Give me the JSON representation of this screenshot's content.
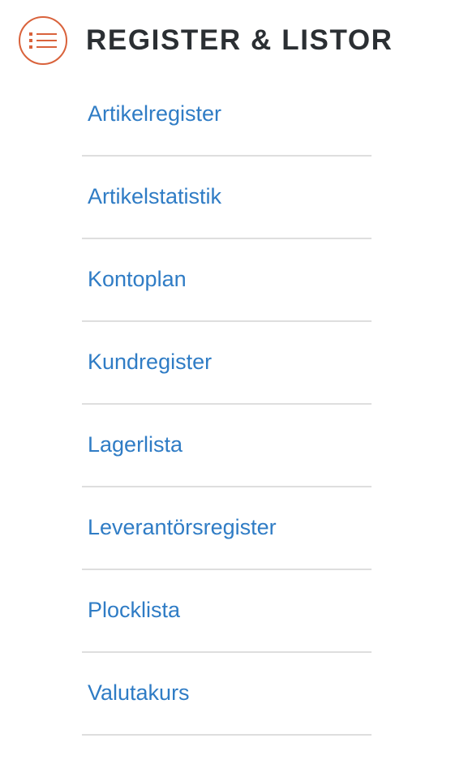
{
  "header": {
    "icon": "list-icon",
    "title": "REGISTER & LISTOR"
  },
  "colors": {
    "accent": "#d9623b",
    "link": "#2f7cc5",
    "title": "#2b2f33",
    "divider": "#dedede"
  },
  "menu": {
    "items": [
      {
        "label": "Artikelregister"
      },
      {
        "label": "Artikelstatistik"
      },
      {
        "label": "Kontoplan"
      },
      {
        "label": "Kundregister"
      },
      {
        "label": "Lagerlista"
      },
      {
        "label": "Leverantörsregister"
      },
      {
        "label": "Plocklista"
      },
      {
        "label": "Valutakurs"
      }
    ]
  }
}
